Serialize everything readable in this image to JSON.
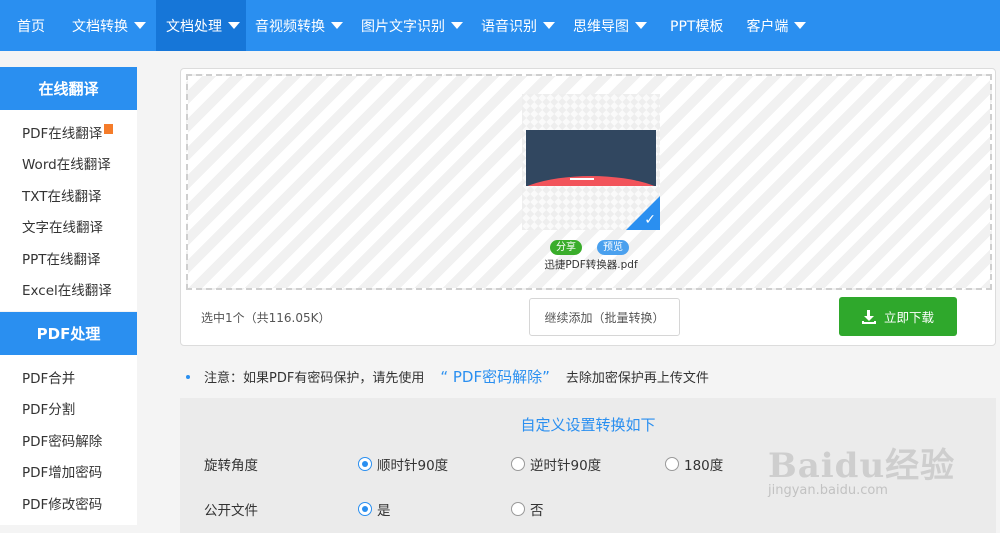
{
  "nav": {
    "items": [
      {
        "label": "首页",
        "dropdown": false
      },
      {
        "label": "文档转换",
        "dropdown": true
      },
      {
        "label": "文档处理",
        "dropdown": true,
        "active": true
      },
      {
        "label": "音视频转换",
        "dropdown": true
      },
      {
        "label": "图片文字识别",
        "dropdown": true
      },
      {
        "label": "语音识别",
        "dropdown": true
      },
      {
        "label": "思维导图",
        "dropdown": true
      },
      {
        "label": "PPT模板",
        "dropdown": false
      },
      {
        "label": "客户端",
        "dropdown": true
      }
    ]
  },
  "sidebar": {
    "sections": [
      {
        "title": "在线翻译",
        "items": [
          "PDF在线翻译",
          "Word在线翻译",
          "TXT在线翻译",
          "文字在线翻译",
          "PPT在线翻译",
          "Excel在线翻译"
        ]
      },
      {
        "title": "PDF处理",
        "items": [
          "PDF合并",
          "PDF分割",
          "PDF密码解除",
          "PDF增加密码",
          "PDF修改密码"
        ]
      }
    ]
  },
  "upload": {
    "file_name": "迅捷PDF转换器.pdf",
    "share_label": "分享",
    "preview_label": "预览",
    "status_text": "选中1个（共116.05K）",
    "add_label": "继续添加（批量转换）",
    "download_label": "立即下载"
  },
  "notice": {
    "prefix": "注意：如果PDF有密码保护，请先使用",
    "link": "“ PDF密码解除”",
    "suffix": "去除加密保护再上传文件"
  },
  "settings": {
    "title": "自定义设置转换如下",
    "rotation": {
      "label": "旋转角度",
      "options": [
        "顺时针90度",
        "逆时针90度",
        "180度"
      ],
      "selected": "顺时针90度"
    },
    "public": {
      "label": "公开文件",
      "options": [
        "是",
        "否"
      ],
      "selected": "是"
    }
  },
  "watermark": {
    "brand": "Baidu经验",
    "url": "jingyan.baidu.com"
  },
  "colors": {
    "primary": "#2a8ff0",
    "nav_active": "#1676d8",
    "download": "#2fa82c"
  }
}
